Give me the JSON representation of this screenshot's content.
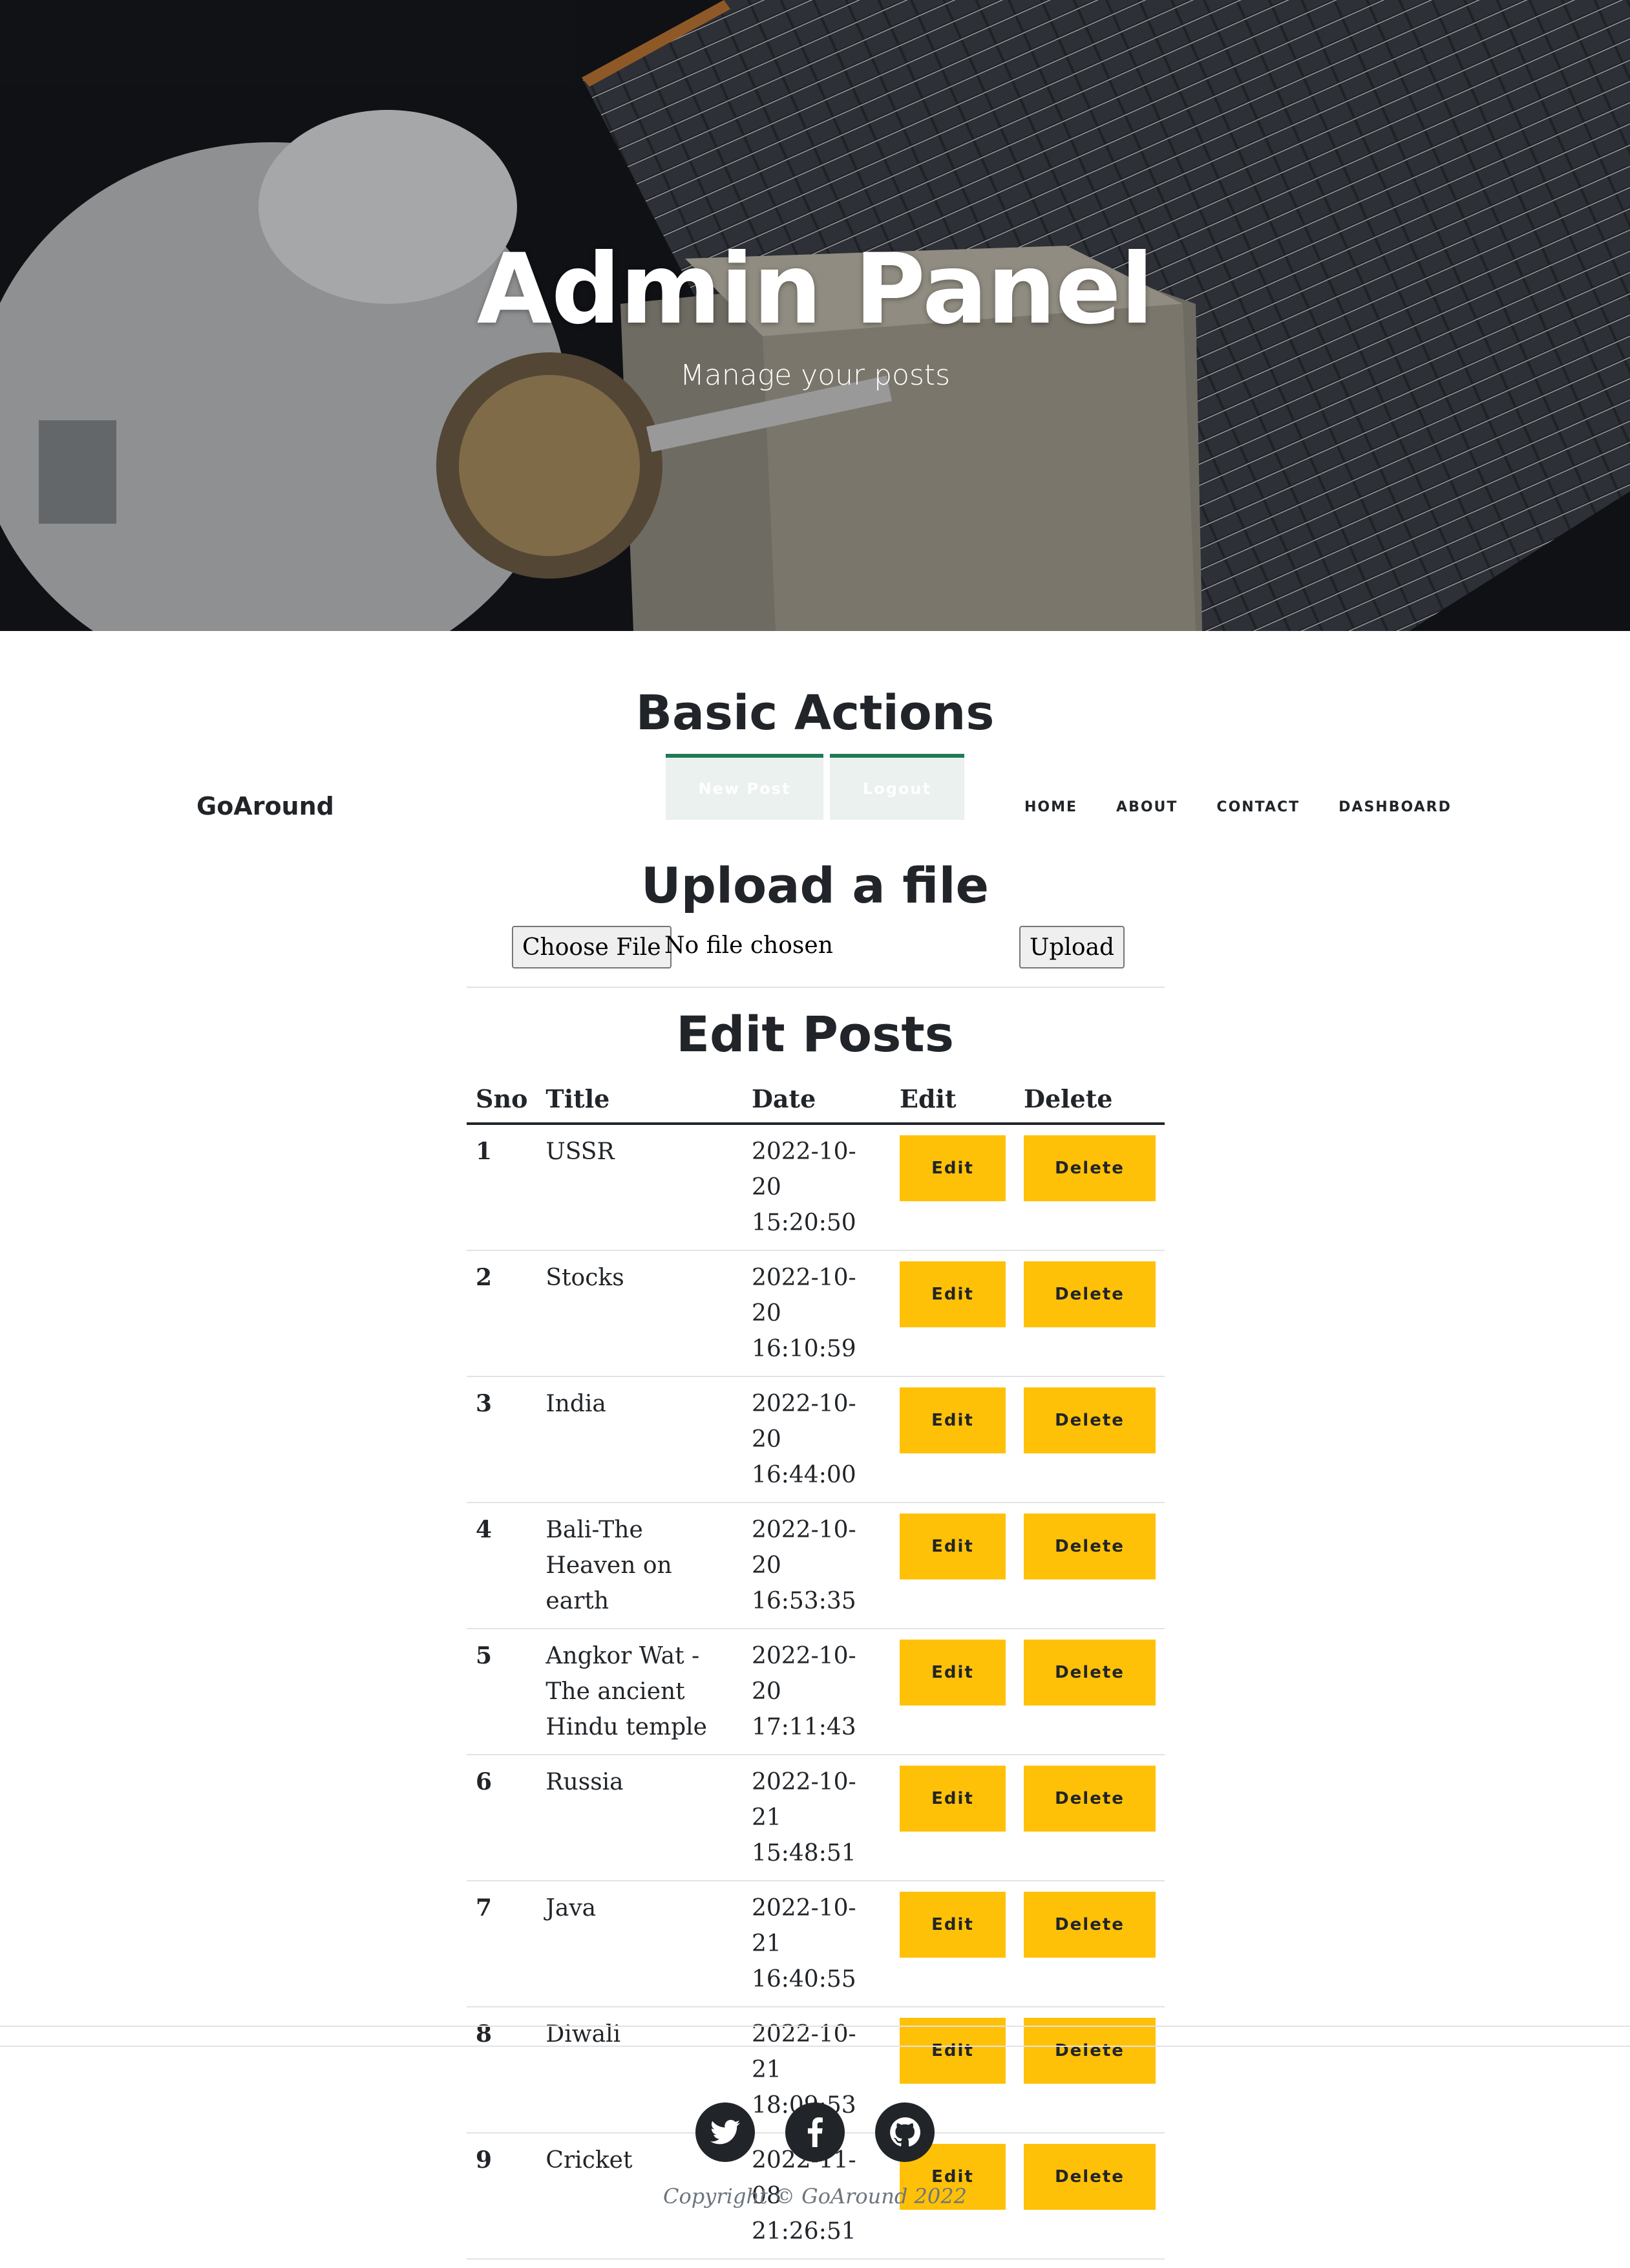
{
  "hero": {
    "title": "Admin Panel",
    "subtitle": "Manage your posts"
  },
  "basic_actions": {
    "heading": "Basic Actions",
    "new_post_label": "New Post",
    "logout_label": "Logout",
    "accent_color": "#1f7a55"
  },
  "navbar": {
    "brand": "GoAround",
    "links": [
      "HOME",
      "ABOUT",
      "CONTACT",
      "DASHBOARD"
    ]
  },
  "upload": {
    "heading": "Upload a file",
    "choose_label": "Choose File",
    "status": "No file chosen",
    "upload_label": "Upload"
  },
  "edit_posts": {
    "heading": "Edit Posts",
    "columns": [
      "Sno",
      "Title",
      "Date",
      "Edit",
      "Delete"
    ],
    "button_color": "#ffc107",
    "edit_label": "Edit",
    "delete_label": "Delete",
    "rows": [
      {
        "sno": "1",
        "title": "USSR",
        "date": "2022-10-20 15:20:50"
      },
      {
        "sno": "2",
        "title": "Stocks",
        "date": "2022-10-20 16:10:59"
      },
      {
        "sno": "3",
        "title": "India",
        "date": "2022-10-20 16:44:00"
      },
      {
        "sno": "4",
        "title": "Bali-The Heaven on earth",
        "date": "2022-10-20 16:53:35"
      },
      {
        "sno": "5",
        "title": "Angkor Wat - The ancient Hindu temple",
        "date": "2022-10-20 17:11:43"
      },
      {
        "sno": "6",
        "title": "Russia",
        "date": "2022-10-21 15:48:51"
      },
      {
        "sno": "7",
        "title": "Java",
        "date": "2022-10-21 16:40:55"
      },
      {
        "sno": "8",
        "title": "Diwali",
        "date": "2022-10-21 18:09:53"
      },
      {
        "sno": "9",
        "title": "Cricket",
        "date": "2022-11-08 21:26:51"
      }
    ]
  },
  "footer": {
    "social_icons": [
      "twitter-icon",
      "facebook-icon",
      "github-icon"
    ],
    "copyright": "Copyright © GoAround 2022"
  }
}
